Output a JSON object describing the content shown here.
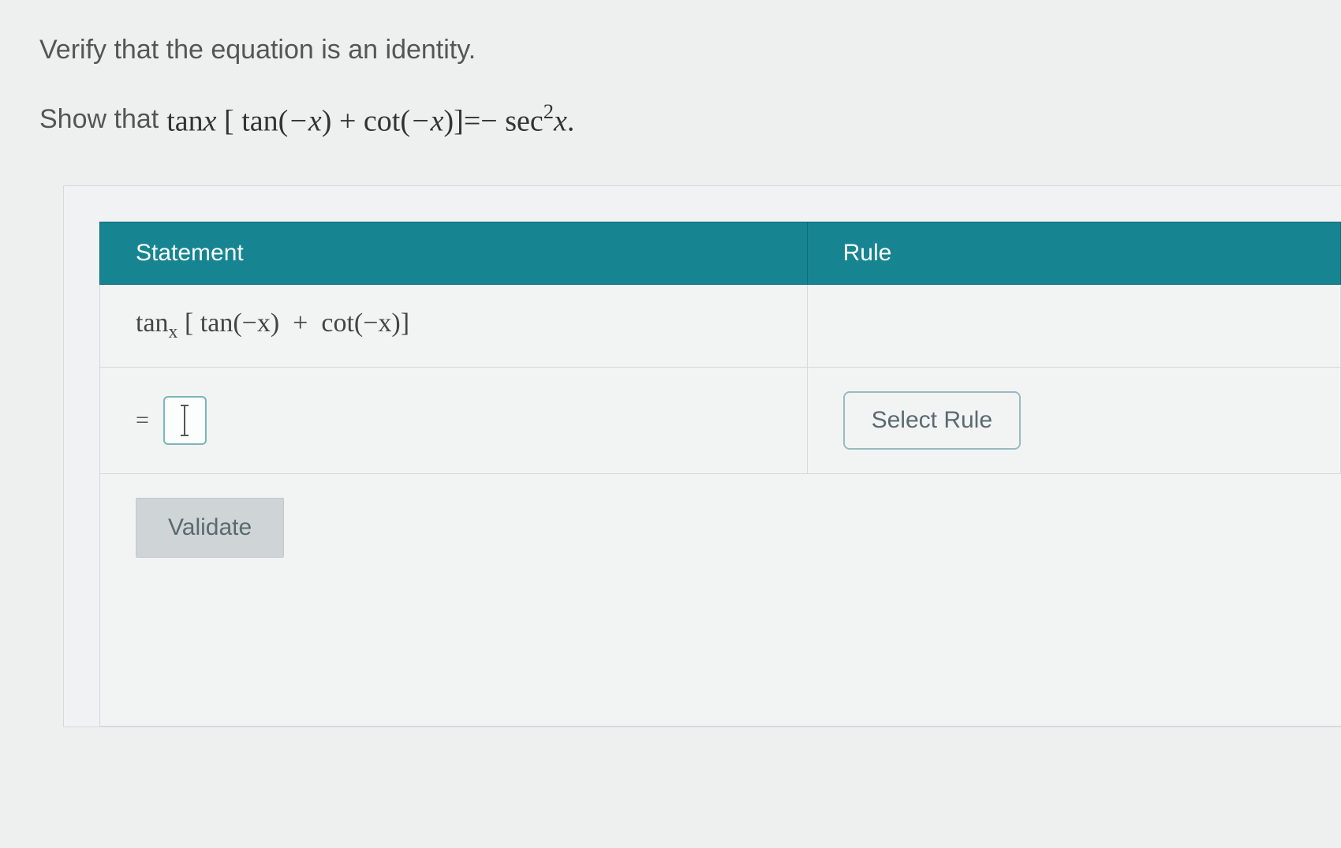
{
  "instruction": "Verify that the equation is an identity.",
  "show_that_label": "Show that",
  "equation": {
    "lhs_prefix": "tan",
    "lhs_var": "x",
    "bracket_open": "[",
    "term1_func": "tan",
    "term1_arg_open": "(",
    "term1_arg": "−x",
    "term1_arg_close": ")",
    "plus": "+",
    "term2_func": "cot",
    "term2_arg_open": "(",
    "term2_arg": "−x",
    "term2_arg_close": ")",
    "bracket_close": "]",
    "equals": "=",
    "rhs_neg": "−",
    "rhs_func": "sec",
    "rhs_sup": "2",
    "rhs_var": "x",
    "period": "."
  },
  "table": {
    "header_statement": "Statement",
    "header_rule": "Rule",
    "row1_statement": {
      "prefix": "tan",
      "sub": "x",
      "bracket_open": "[",
      "t1_func": "tan",
      "t1_open": "(",
      "t1_arg": "−x",
      "t1_close": ")",
      "plus": "+",
      "t2_func": "cot",
      "t2_open": "(",
      "t2_arg": "−x",
      "t2_close": ")",
      "bracket_close": "]"
    },
    "eq_sign": "=",
    "select_rule_label": "Select Rule",
    "validate_label": "Validate"
  }
}
